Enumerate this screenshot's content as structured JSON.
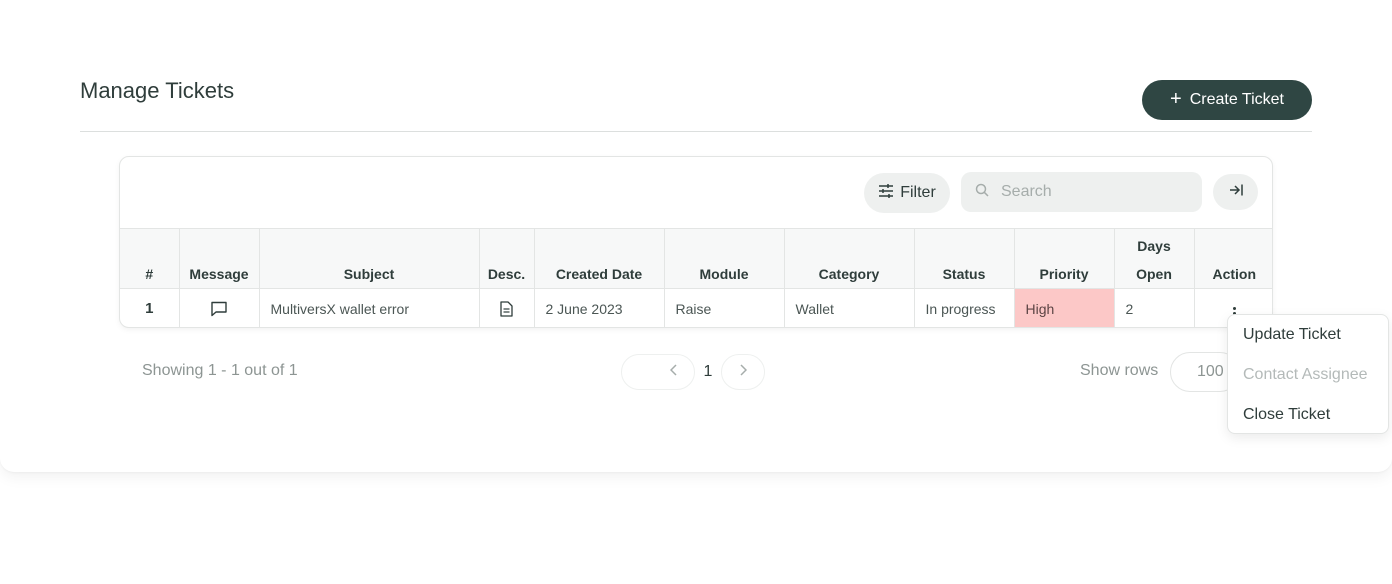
{
  "page": {
    "title": "Manage Tickets",
    "create_button": {
      "label": "Create Ticket",
      "icon": "plus-icon"
    }
  },
  "toolbar": {
    "filter_label": "Filter",
    "filter_icon": "sliders-icon",
    "search_placeholder": "Search",
    "search_value": "",
    "export_icon": "arrow-to-right-icon"
  },
  "table": {
    "headers": {
      "num": "#",
      "message": "Message",
      "subject": "Subject",
      "desc": "Desc.",
      "created": "Created Date",
      "module": "Module",
      "category": "Category",
      "status": "Status",
      "priority": "Priority",
      "days_line1": "Days",
      "days_line2": "Open",
      "action": "Action"
    },
    "rows": [
      {
        "num": "1",
        "message_icon": "chat-bubble-icon",
        "subject": "MultiversX wallet error",
        "desc_icon": "document-icon",
        "created": "2 June 2023",
        "module": "Raise",
        "category": "Wallet",
        "status": "In progress",
        "priority": "High",
        "priority_color": "#fcc8c7",
        "days_open": "2",
        "action_icon": "kebab-menu-icon"
      }
    ]
  },
  "footer": {
    "showing": "Showing 1 - 1 out of 1",
    "current_page": "1",
    "show_rows_label": "Show rows",
    "rows_value": "100"
  },
  "action_menu": {
    "items": [
      {
        "label": "Update Ticket",
        "enabled": true
      },
      {
        "label": "Contact Assignee",
        "enabled": false
      },
      {
        "label": "Close Ticket",
        "enabled": true
      }
    ]
  },
  "colors": {
    "primary": "#2f4643",
    "priority_high": "#fcc8c7"
  }
}
